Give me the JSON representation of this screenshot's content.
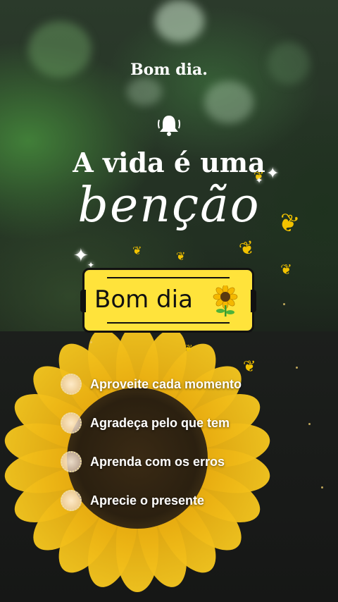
{
  "greeting": "Bom dia.",
  "headline": "A vida é uma",
  "script_word": "bençãо",
  "sticker": {
    "label": "Bom dia",
    "icon": "sunflower-icon"
  },
  "checklist": [
    {
      "label": "Aproveite cada momento"
    },
    {
      "label": "Agradeça pelo que tem"
    },
    {
      "label": "Aprenda com os erros"
    },
    {
      "label": "Aprecie o presente"
    }
  ],
  "colors": {
    "sticker_bg": "#ffe33b",
    "petal": "#f7c81f",
    "butterfly": "#f2c200",
    "text": "#ffffff"
  }
}
